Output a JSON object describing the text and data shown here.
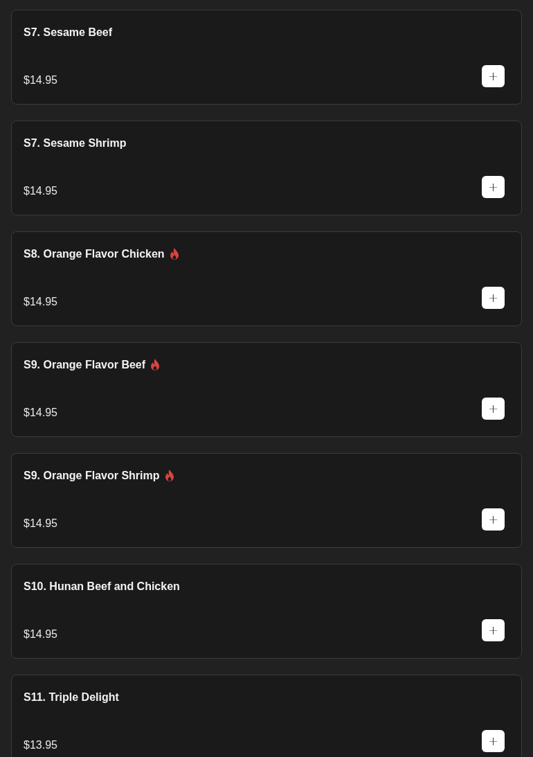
{
  "menu_items": [
    {
      "name": "S7. Sesame Beef",
      "spicy": false,
      "price": "$14.95",
      "add": "+"
    },
    {
      "name": "S7. Sesame Shrimp",
      "spicy": false,
      "price": "$14.95",
      "add": "+"
    },
    {
      "name": "S8. Orange Flavor Chicken",
      "spicy": true,
      "price": "$14.95",
      "add": "+"
    },
    {
      "name": "S9. Orange Flavor Beef",
      "spicy": true,
      "price": "$14.95",
      "add": "+"
    },
    {
      "name": "S9. Orange Flavor Shrimp",
      "spicy": true,
      "price": "$14.95",
      "add": "+"
    },
    {
      "name": "S10. Hunan Beef and Chicken",
      "spicy": false,
      "price": "$14.95",
      "add": "+"
    },
    {
      "name": "S11. Triple Delight",
      "spicy": false,
      "price": "$13.95",
      "add": "+"
    }
  ]
}
